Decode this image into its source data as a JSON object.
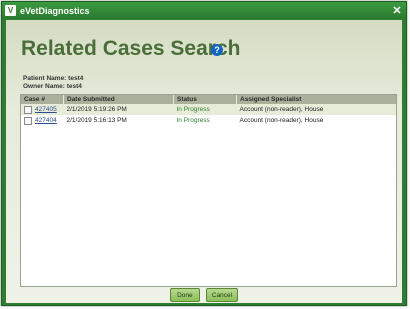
{
  "window": {
    "app_logo": "V",
    "title": "eVetDiagnostics",
    "close_glyph": "✕"
  },
  "page": {
    "title": "Related Cases Search",
    "help_glyph": "?"
  },
  "info": {
    "patient_label": "Patient Name:",
    "patient_value": "test4",
    "owner_label": "Owner Name:",
    "owner_value": "test4"
  },
  "table": {
    "headers": [
      "Case #",
      "Date Submitted",
      "Status",
      "Assigned Specialist"
    ],
    "rows": [
      {
        "case": "427405",
        "date": "2/1/2019 5:19:26 PM",
        "status": "In Progress",
        "specialist": "Account (non-reader), House"
      },
      {
        "case": "427404",
        "date": "2/1/2019 5:16:13 PM",
        "status": "In Progress",
        "specialist": "Account (non-reader), House"
      }
    ]
  },
  "buttons": {
    "done": "Done",
    "cancel": "Cancel"
  },
  "colors": {
    "frame": "#2e7d32",
    "title_text": "#4a6e3a",
    "status_text": "#2e7d32",
    "link": "#2b4e8c"
  },
  "icons": {
    "help": "help-circle-icon",
    "close": "close-icon",
    "logo": "app-logo-icon"
  }
}
